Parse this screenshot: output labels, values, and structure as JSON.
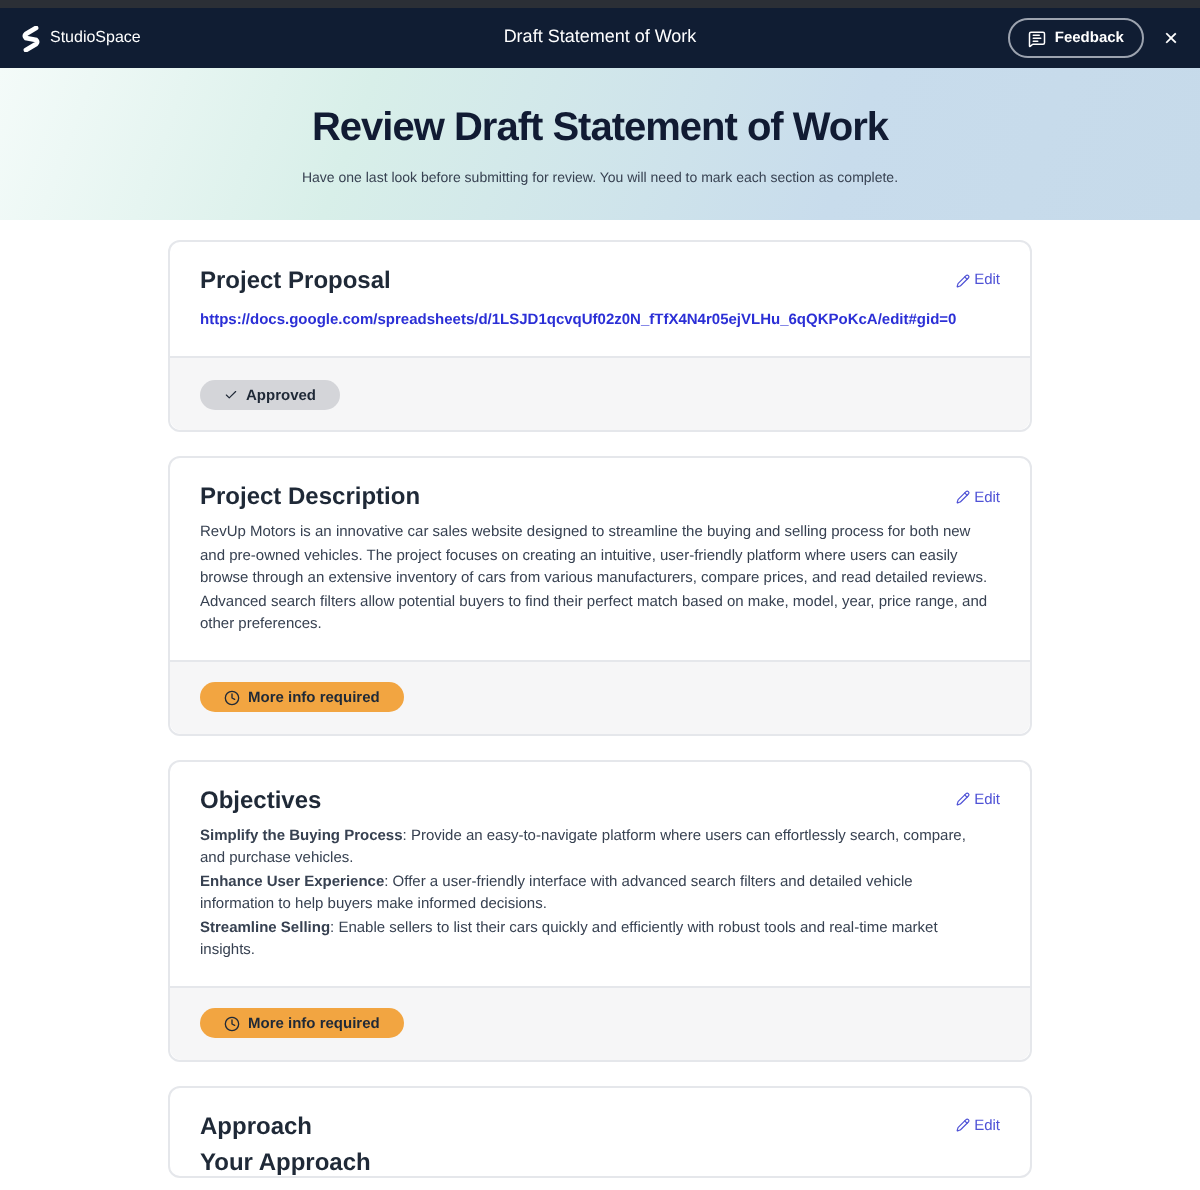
{
  "header": {
    "brand": "StudioSpace",
    "title": "Draft Statement of Work",
    "feedback": "Feedback",
    "close": "×"
  },
  "hero": {
    "title": "Review Draft Statement of Work",
    "subtitle": "Have one last look before submitting for review. You will need to mark each section as complete."
  },
  "sections": [
    {
      "title": "Project Proposal",
      "edit": "Edit",
      "kind": "link",
      "link": "https://docs.google.com/spreadsheets/d/1LSJD1qcvqUf02z0N_fTfX4N4r05ejVLHu_6qQKPoKcA/edit#gid=0",
      "status": {
        "kind": "approved",
        "label": "Approved"
      }
    },
    {
      "title": "Project Description",
      "edit": "Edit",
      "kind": "paragraph",
      "text": "RevUp Motors is an innovative car sales website designed to streamline the buying and selling process for both new and pre-owned vehicles. The project focuses on creating an intuitive, user-friendly platform where users can easily browse through an extensive inventory of cars from various manufacturers, compare prices, and read detailed reviews. Advanced search filters allow potential buyers to find their perfect match based on make, model, year, price range, and other preferences.",
      "status": {
        "kind": "more_info",
        "label": "More info required"
      }
    },
    {
      "title": "Objectives",
      "edit": "Edit",
      "kind": "list",
      "items": [
        "**Simplify the Buying Process**: Provide an easy-to-navigate platform where users can effortlessly search, compare, and purchase vehicles.",
        "**Enhance User Experience**: Offer a user-friendly interface with advanced search filters and detailed vehicle information to help buyers make informed decisions.",
        "**Streamline Selling**: Enable sellers to list their cars quickly and efficiently with robust tools and real-time market insights."
      ],
      "status": {
        "kind": "more_info",
        "label": "More info required"
      }
    },
    {
      "title": "Approach",
      "edit": "Edit",
      "kind": "subheading",
      "text": "Your Approach"
    }
  ]
}
